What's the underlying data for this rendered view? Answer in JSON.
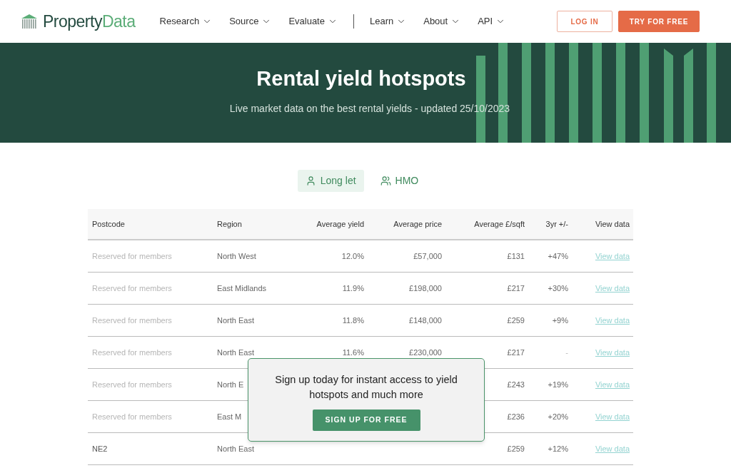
{
  "logo": {
    "part1": "Property",
    "part2": "Data"
  },
  "nav": [
    [
      {
        "label": "Research"
      },
      {
        "label": "Source"
      },
      {
        "label": "Evaluate"
      }
    ],
    [
      {
        "label": "Learn"
      },
      {
        "label": "About"
      },
      {
        "label": "API"
      }
    ]
  ],
  "header_buttons": [
    {
      "label": "LOG IN",
      "kind": "outline"
    },
    {
      "label": "TRY FOR FREE",
      "kind": "solid"
    }
  ],
  "hero": {
    "title": "Rental yield hotspots",
    "subtitle": "Live market data on the best rental yields - updated 25/10/2023"
  },
  "tabs": [
    {
      "label": "Long let",
      "kind": "single",
      "selected": true
    },
    {
      "label": "HMO",
      "kind": "group",
      "selected": false
    }
  ],
  "table": {
    "columns": [
      "Postcode",
      "Region",
      "Average yield",
      "Average price",
      "Average £/sqft",
      "3yr +/-",
      "View data"
    ],
    "rows": [
      {
        "postcode": "Reserved for members",
        "locked": true,
        "region": "North West",
        "yield": "12.0%",
        "price": "£57,000",
        "sqft": "£131",
        "change": "+47%",
        "link": "View data"
      },
      {
        "postcode": "Reserved for members",
        "locked": true,
        "region": "East Midlands",
        "yield": "11.9%",
        "price": "£198,000",
        "sqft": "£217",
        "change": "+30%",
        "link": "View data"
      },
      {
        "postcode": "Reserved for members",
        "locked": true,
        "region": "North East",
        "yield": "11.8%",
        "price": "£148,000",
        "sqft": "£259",
        "change": "+9%",
        "link": "View data"
      },
      {
        "postcode": "Reserved for members",
        "locked": true,
        "region": "North East",
        "yield": "11.6%",
        "price": "£230,000",
        "sqft": "£217",
        "change": "-",
        "link": "View data"
      },
      {
        "postcode": "Reserved for members",
        "locked": true,
        "region": "North E",
        "sqft": "£243",
        "change": "+19%",
        "link": "View data"
      },
      {
        "postcode": "Reserved for members",
        "locked": true,
        "region": "East M",
        "sqft": "£236",
        "change": "+20%",
        "link": "View data"
      },
      {
        "postcode": "NE2",
        "locked": false,
        "region": "North East",
        "sqft": "£259",
        "change": "+12%",
        "link": "View data"
      }
    ]
  },
  "signup": {
    "text": "Sign up today for instant access to yield hotspots and much more",
    "button": "SIGN UP FOR FREE"
  }
}
